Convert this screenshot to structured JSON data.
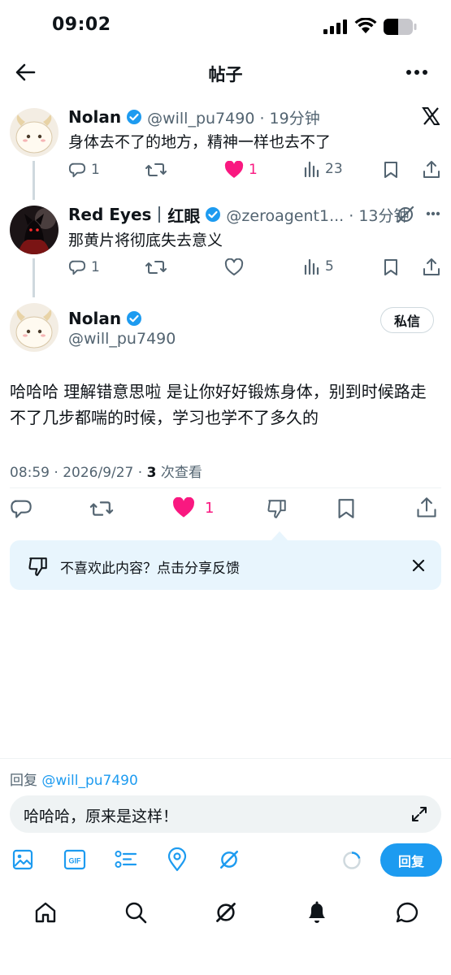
{
  "status_bar": {
    "time": "09:02"
  },
  "header": {
    "title": "帖子"
  },
  "posts": [
    {
      "name": "Nolan",
      "handle_time": "@will_pu7490 · 19分钟",
      "text": "身体去不了的地方，精神一样也去不了",
      "replies": "1",
      "likes": "1",
      "views": "23"
    },
    {
      "name": "Red Eyes",
      "name_extra": "红眼",
      "handle_time": "@zeroagent1... · 13分钟",
      "text": "那黄片将彻底失去意义",
      "replies": "1",
      "views": "5"
    }
  ],
  "main_post": {
    "name": "Nolan",
    "handle": "@will_pu7490",
    "dm_label": "私信",
    "text": "哈哈哈 理解错意思啦 是让你好好锻炼身体，别到时候路走不了几步都喘的时候，学习也学不了多久的",
    "time_date": "08:59 · 2026/9/27 · ",
    "views_count": "3",
    "views_label": " 次查看",
    "likes": "1"
  },
  "feedback": {
    "text": "不喜欢此内容？点击分享反馈"
  },
  "reply": {
    "prefix": "回复 ",
    "handle": "@will_pu7490",
    "draft": "哈哈哈，原来是这样！",
    "send_label": "回复"
  },
  "colors": {
    "accent": "#1d9bf0",
    "like": "#f91880",
    "muted": "#536471",
    "feedback_bg": "#e8f5fd"
  },
  "icons": [
    "back-arrow-icon",
    "more-icon",
    "x-logo-icon",
    "verified-icon",
    "reply-icon",
    "retweet-icon",
    "heart-icon",
    "views-icon",
    "bookmark-icon",
    "share-icon",
    "grok-icon",
    "dislike-icon",
    "close-icon",
    "expand-icon",
    "image-icon",
    "gif-icon",
    "poll-icon",
    "location-icon",
    "home-icon",
    "search-icon",
    "notifications-icon",
    "messages-icon"
  ]
}
